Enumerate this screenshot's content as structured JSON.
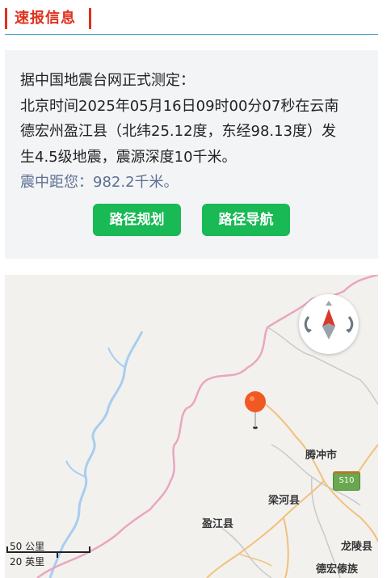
{
  "header": {
    "title": "速报信息"
  },
  "report": {
    "line1": "据中国地震台网正式测定：",
    "line2": "北京时间2025年05月16日09时00分07秒在云南",
    "line3": "德宏州盈江县（北纬25.12度，东经98.13度）发",
    "line4": "生4.5级地震，震源深度10千米。",
    "distance": "震中距您：982.2千米。"
  },
  "buttons": {
    "route_plan": "路径规划",
    "route_nav": "路径导航"
  },
  "map": {
    "labels": {
      "tengchong": "腾冲市",
      "lianghe": "梁河县",
      "yingjiang": "盈江县",
      "longling": "龙陵县",
      "dehong": "德宏傣族"
    },
    "road_shield": "S10",
    "scale_km": "50 公里",
    "scale_mi": "20 英里"
  },
  "colors": {
    "accent": "#e0301e",
    "button": "#19b955",
    "distance_text": "#5d6f91"
  }
}
